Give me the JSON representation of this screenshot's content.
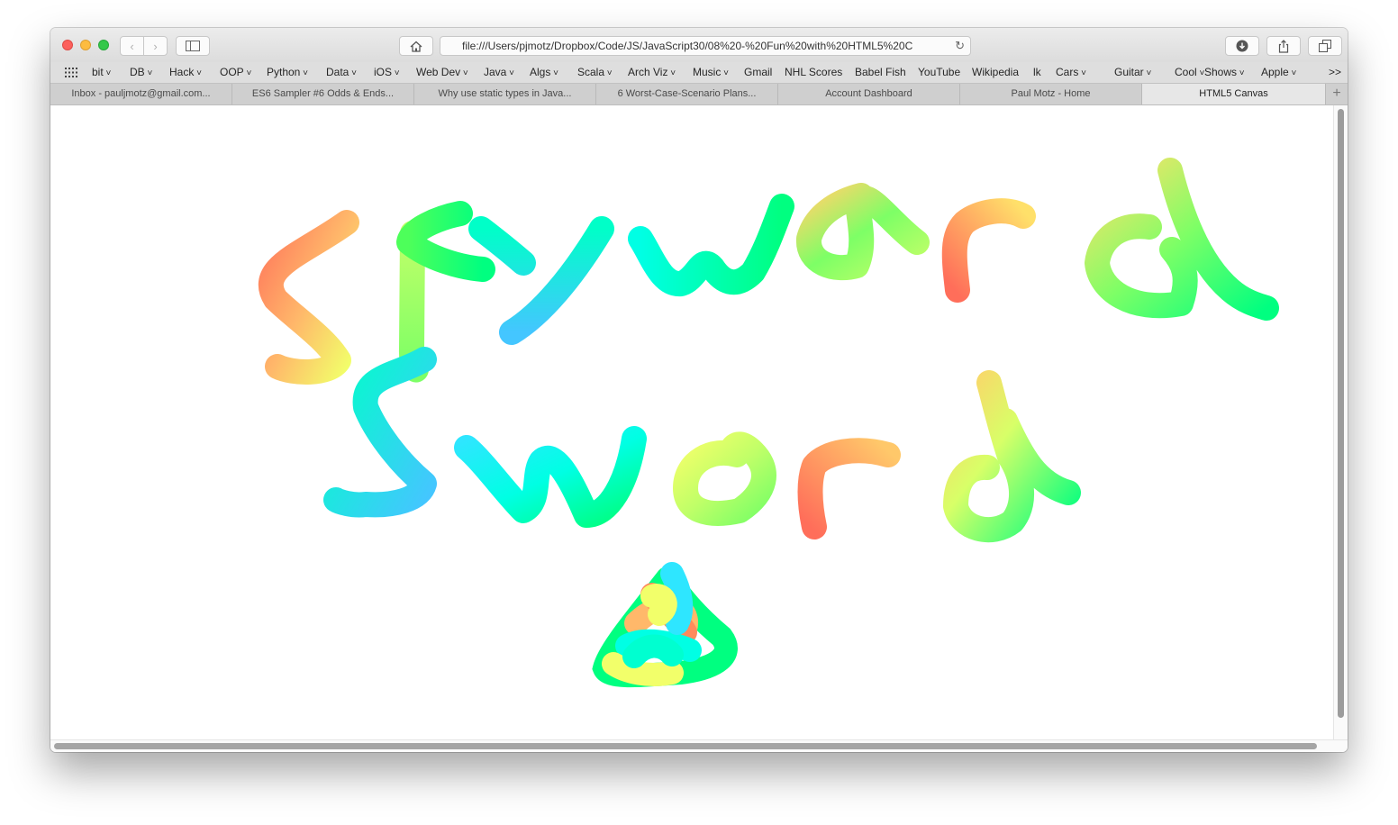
{
  "browser": {
    "url": "file:///Users/pjmotz/Dropbox/Code/JS/JavaScript30/08%20-%20Fun%20with%20HTML5%20C",
    "bookmarks": [
      "bit",
      "DB",
      "Hack",
      "OOP",
      "Python",
      "Data",
      "iOS",
      "Web Dev",
      "Java",
      "Algs",
      "Scala",
      "Arch Viz",
      "Music",
      "Gmail",
      "NHL Scores",
      "Babel Fish",
      "YouTube",
      "Wikipedia",
      "lk",
      "Cars",
      "Guitar",
      "Cool",
      "Shows",
      "Apple"
    ],
    "bookmark_dropdowns": [
      true,
      true,
      true,
      true,
      true,
      true,
      true,
      true,
      true,
      true,
      true,
      true,
      true,
      false,
      false,
      false,
      false,
      false,
      false,
      true,
      true,
      true,
      true,
      true
    ],
    "overflow_label": ">>",
    "tabs": [
      "Inbox - pauljmotz@gmail.com...",
      "ES6 Sampler #6 Odds & Ends...",
      "Why use static types in Java...",
      "6 Worst-Case-Scenario Plans...",
      "Account Dashboard",
      "Paul Motz - Home",
      "HTML5 Canvas"
    ],
    "active_tab_index": 6,
    "new_tab_label": "+"
  },
  "canvas": {
    "drawn_words": [
      "Skyward",
      "Sword"
    ],
    "stroke_palette": [
      "#ff7a5c",
      "#ffb86a",
      "#f2ff6a",
      "#c0ff68",
      "#7dff66",
      "#00ff80",
      "#00ffe4",
      "#2ee6ff",
      "#44c6ff"
    ]
  }
}
